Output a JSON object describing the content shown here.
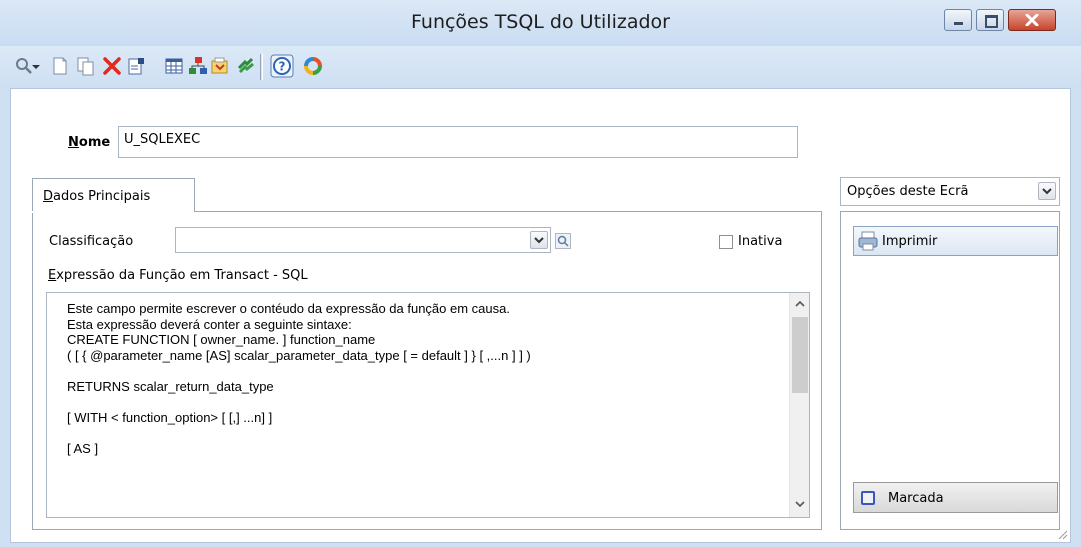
{
  "window": {
    "title": "Funções TSQL do Utilizador"
  },
  "toolbar": {
    "icons": [
      "search-icon",
      "dropdown-arrow-icon",
      "new-document-icon",
      "copy-icon",
      "delete-icon",
      "properties-icon",
      "table-icon",
      "hierarchy-icon",
      "export-icon",
      "refresh-icon",
      "help-icon",
      "cycle-icon"
    ]
  },
  "form": {
    "nome_label_prefix": "N",
    "nome_label_rest": "ome",
    "nome_value": "U_SQLEXEC",
    "tab_label_prefix": "D",
    "tab_label_rest": "ados Principais",
    "classificacao_label": "Classificação",
    "classificacao_value": "",
    "inativa_label": "Inativa",
    "expressao_label_prefix": "E",
    "expressao_label_rest": "xpressão da Função em Transact - SQL",
    "expressao_lines": [
      "Este campo permite escrever o contéudo da expressão da função em causa.",
      "Esta expressão deverá conter a seguinte sintaxe:",
      "CREATE FUNCTION [ owner_name. ] function_name",
      "( [ { @parameter_name [AS] scalar_parameter_data_type [ = default ] } [ ,...n ] ] )",
      "",
      "RETURNS scalar_return_data_type",
      "",
      "[ WITH < function_option> [ [,] ...n] ]",
      "",
      "[ AS ]"
    ]
  },
  "side": {
    "options_label": "Opções deste Ecrã",
    "imprimir_label": "Imprimir",
    "marcada_label": "Marcada"
  },
  "colors": {
    "accent": "#cfe0f3",
    "close": "#c8442d"
  }
}
